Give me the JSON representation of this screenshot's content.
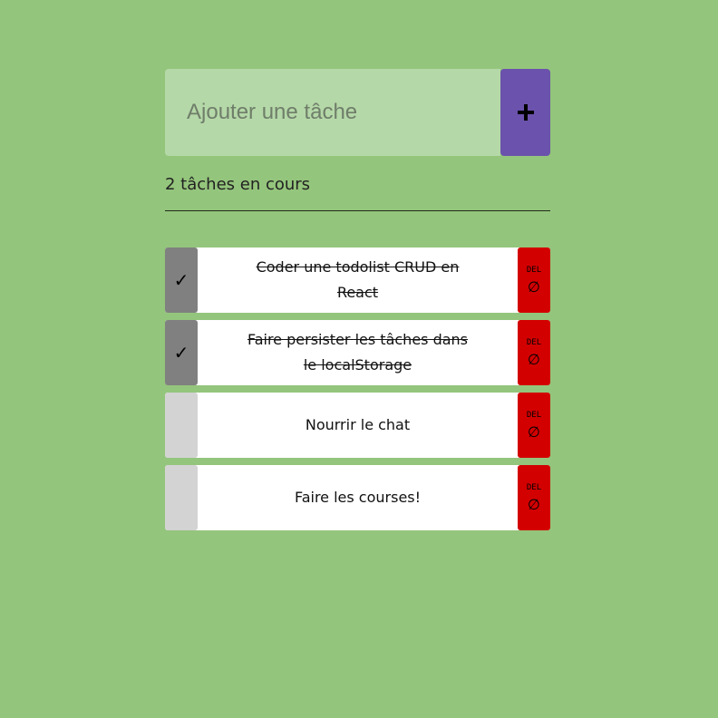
{
  "add_form": {
    "placeholder": "Ajouter une tâche",
    "value": "",
    "button_icon": "plus-icon"
  },
  "counter_text": "2 tâches en cours",
  "tasks": [
    {
      "text": "Coder une todolist CRUD en React",
      "done": true,
      "check_glyph": "✓",
      "delete_label": "DEL",
      "delete_symbol": "∅"
    },
    {
      "text": "Faire persister les tâches dans le localStorage",
      "done": true,
      "check_glyph": "✓",
      "delete_label": "DEL",
      "delete_symbol": "∅"
    },
    {
      "text": "Nourrir le chat",
      "done": false,
      "check_glyph": "",
      "delete_label": "DEL",
      "delete_symbol": "∅"
    },
    {
      "text": "Faire les courses!",
      "done": false,
      "check_glyph": "",
      "delete_label": "DEL",
      "delete_symbol": "∅"
    }
  ],
  "colors": {
    "background": "#94c57c",
    "input_bg": "#b5d8a8",
    "add_button": "#6b52ac",
    "check_done": "#808080",
    "check_todo": "#d3d3d3",
    "delete": "#d30000"
  }
}
